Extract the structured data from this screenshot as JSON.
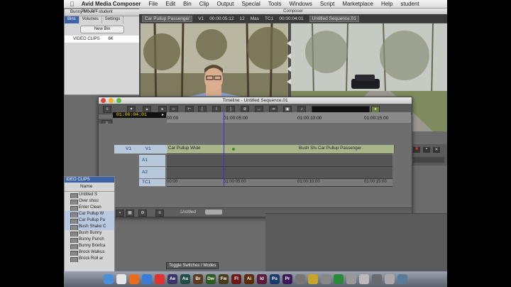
{
  "menubar": {
    "app_name": "Avid Media Composer",
    "items": [
      "File",
      "Edit",
      "Bin",
      "Clip",
      "Output",
      "Special",
      "Tools",
      "Windows",
      "Script",
      "Marketplace",
      "Help",
      "student"
    ]
  },
  "bin_panel": {
    "title": "Bunny Movie - student",
    "tabs": [
      "Bins",
      "Volumes",
      "Settings"
    ],
    "new_bin_label": "New Bin",
    "bin_name": "VIDEO CLIPS",
    "bin_size": "6K"
  },
  "composer": {
    "title": "Composer",
    "source_clip": "Car Pullup Passenger",
    "v1_label": "V1",
    "source_tc": "00:00:05:12",
    "record_tc_prefix": "12",
    "mas_label": "Mas",
    "tc1_label": "TC1",
    "record_tc": "00:00:04:01",
    "sequence_name": "Untitled Sequence.01"
  },
  "bin_small_title": "Bun..ent",
  "timeline": {
    "title": "Timeline - Untitled Sequence.01",
    "timecode": "01:00:04:01",
    "ruler_ticks": [
      "00:00",
      "01:00:05:00",
      "01:00:10:00",
      "01:00:15:00"
    ],
    "tc_ticks": [
      "00:00",
      "01:00:05:00",
      "01:00:10:00",
      "01:00:15:00"
    ],
    "tracks": [
      {
        "src": "V1",
        "rec": "V1"
      },
      {
        "src": "",
        "rec": "A1"
      },
      {
        "src": "",
        "rec": "A2"
      },
      {
        "src": "",
        "rec": "TC1"
      }
    ],
    "clips": [
      "Car Pullup Wide",
      "Bush Sha",
      "Car Pullup Passenger"
    ],
    "footer_label": "Untitled"
  },
  "clip_bin": {
    "header": "IDEO CLIPS",
    "col_name": "Name",
    "items": [
      {
        "label": "Untitled S",
        "selected": false
      },
      {
        "label": "Over shou",
        "selected": false
      },
      {
        "label": "Enter Clean",
        "selected": false
      },
      {
        "label": "Car Pullup W",
        "selected": true
      },
      {
        "label": "Car Pullup Pa",
        "selected": true
      },
      {
        "label": "Bush Shake C",
        "selected": true
      },
      {
        "label": "Bush Bunny",
        "selected": false
      },
      {
        "label": "Bunny Punch",
        "selected": false
      },
      {
        "label": "Bunny Briefca",
        "selected": false
      },
      {
        "label": "Brock Walkus",
        "selected": false
      },
      {
        "label": "Brock Roll ar",
        "selected": false
      }
    ]
  },
  "tooltip": "Toggle Switches / Modes",
  "dock": {
    "icons": [
      {
        "label": "",
        "color": "#4a90d9"
      },
      {
        "label": "",
        "color": "#e6e6e6"
      },
      {
        "label": "",
        "color": "#e86d1f"
      },
      {
        "label": "",
        "color": "#3a7bd5"
      },
      {
        "label": "",
        "color": "#d33"
      },
      {
        "label": "Ae",
        "color": "#3b3466"
      },
      {
        "label": "Au",
        "color": "#1f4d45"
      },
      {
        "label": "Br",
        "color": "#5a3a20"
      },
      {
        "label": "Dw",
        "color": "#2f5a1f"
      },
      {
        "label": "Fw",
        "color": "#4a3a1a"
      },
      {
        "label": "Fl",
        "color": "#6a1a1a"
      },
      {
        "label": "Ai",
        "color": "#5a2a00"
      },
      {
        "label": "Id",
        "color": "#5a1a3a"
      },
      {
        "label": "Ps",
        "color": "#1a3a6a"
      },
      {
        "label": "Pr",
        "color": "#3a1a5a"
      },
      {
        "label": "",
        "color": "#777"
      },
      {
        "label": "",
        "color": "#c9a42a"
      },
      {
        "label": "",
        "color": "#888"
      },
      {
        "label": "",
        "color": "#2a8a3a"
      },
      {
        "label": "",
        "color": "#999"
      },
      {
        "label": "",
        "color": "#bbb"
      },
      {
        "label": "",
        "color": "#6a6a6a"
      },
      {
        "label": "",
        "color": "#aaa"
      },
      {
        "label": "",
        "color": "#5a7a9a"
      }
    ]
  }
}
